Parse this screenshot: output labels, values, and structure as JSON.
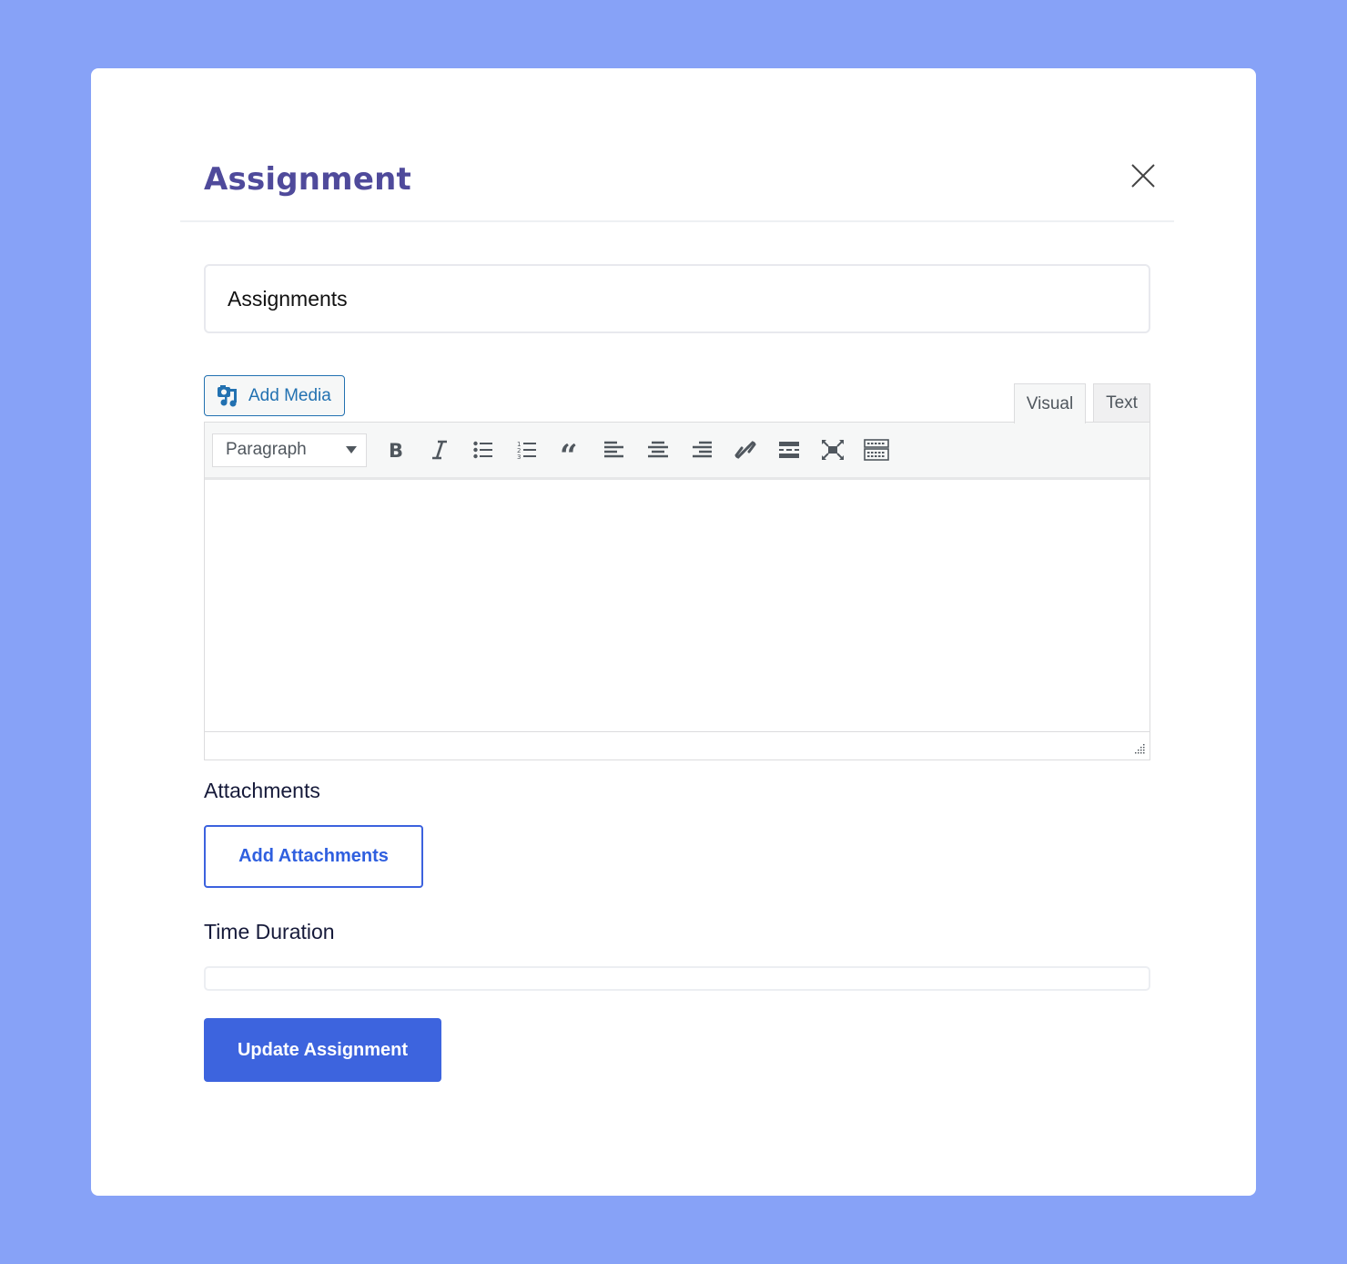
{
  "modal": {
    "title": "Assignment",
    "close_icon": "close-icon"
  },
  "form": {
    "title_input_value": "Assignments",
    "add_media_label": "Add Media",
    "editor_tabs": [
      {
        "label": "Visual",
        "active": true
      },
      {
        "label": "Text",
        "active": false
      }
    ],
    "format_select_value": "Paragraph",
    "toolbar_icons": [
      "bold-icon",
      "italic-icon",
      "bulleted-list-icon",
      "numbered-list-icon",
      "blockquote-icon",
      "align-left-icon",
      "align-center-icon",
      "align-right-icon",
      "link-icon",
      "read-more-icon",
      "fullscreen-icon",
      "toolbar-toggle-icon"
    ],
    "editor_content": "",
    "attachments_label": "Attachments",
    "add_attachments_label": "Add Attachments",
    "time_duration_label": "Time Duration",
    "time_duration_value": "",
    "update_button_label": "Update Assignment"
  },
  "colors": {
    "background": "#87a2f7",
    "title": "#4f4a9b",
    "primary": "#3d64de",
    "wp_link": "#2271b1"
  }
}
